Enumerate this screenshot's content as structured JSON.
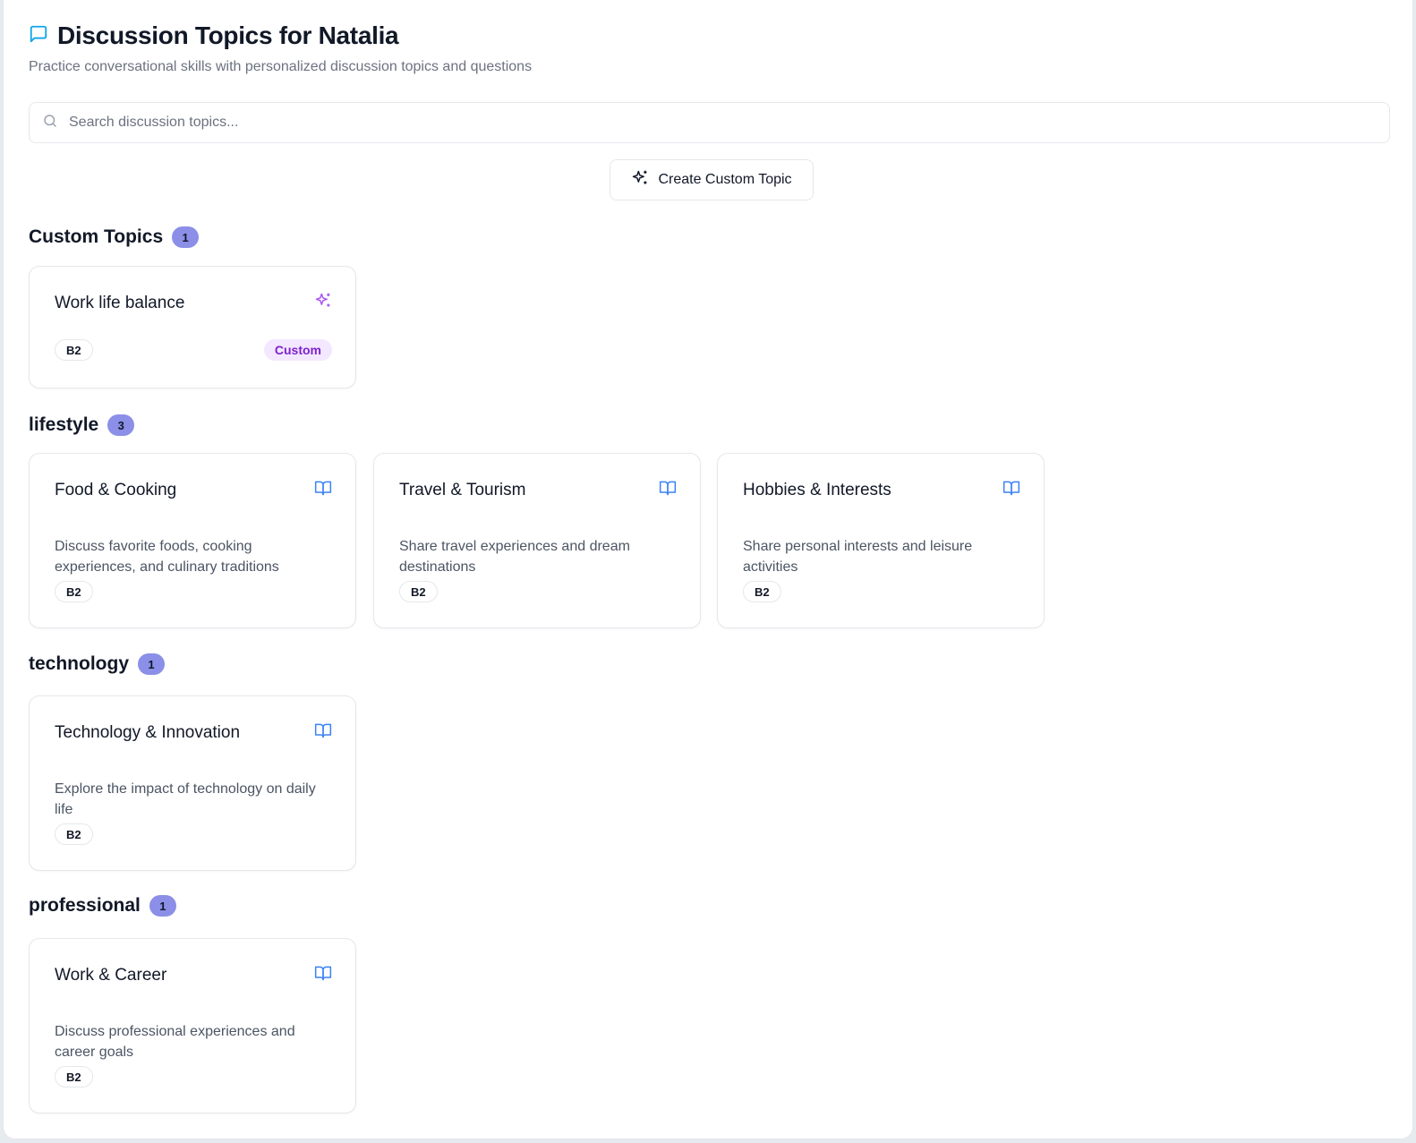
{
  "header": {
    "title": "Discussion Topics for Natalia",
    "subtitle": "Practice conversational skills with personalized discussion topics and questions"
  },
  "search": {
    "placeholder": "Search discussion topics..."
  },
  "create_button": {
    "label": "Create Custom Topic"
  },
  "colors": {
    "accent_blue": "#0ea5e9",
    "badge_purple": "#8b8fe8",
    "custom_purple": "#a855f7",
    "book_blue": "#3b82f6"
  },
  "sections": {
    "custom": {
      "title": "Custom Topics",
      "count": "1",
      "cards": [
        {
          "title": "Work life balance",
          "level": "B2",
          "tag": "Custom",
          "icon": "sparkles-icon"
        }
      ]
    },
    "lifestyle": {
      "title": "lifestyle",
      "count": "3",
      "cards": [
        {
          "title": "Food & Cooking",
          "description": "Discuss favorite foods, cooking experiences, and culinary traditions",
          "level": "B2",
          "icon": "book-icon"
        },
        {
          "title": "Travel & Tourism",
          "description": "Share travel experiences and dream destinations",
          "level": "B2",
          "icon": "book-icon"
        },
        {
          "title": "Hobbies & Interests",
          "description": "Share personal interests and leisure activities",
          "level": "B2",
          "icon": "book-icon"
        }
      ]
    },
    "technology": {
      "title": "technology",
      "count": "1",
      "cards": [
        {
          "title": "Technology & Innovation",
          "description": "Explore the impact of technology on daily life",
          "level": "B2",
          "icon": "book-icon"
        }
      ]
    },
    "professional": {
      "title": "professional",
      "count": "1",
      "cards": [
        {
          "title": "Work & Career",
          "description": "Discuss professional experiences and career goals",
          "level": "B2",
          "icon": "book-icon"
        }
      ]
    }
  }
}
